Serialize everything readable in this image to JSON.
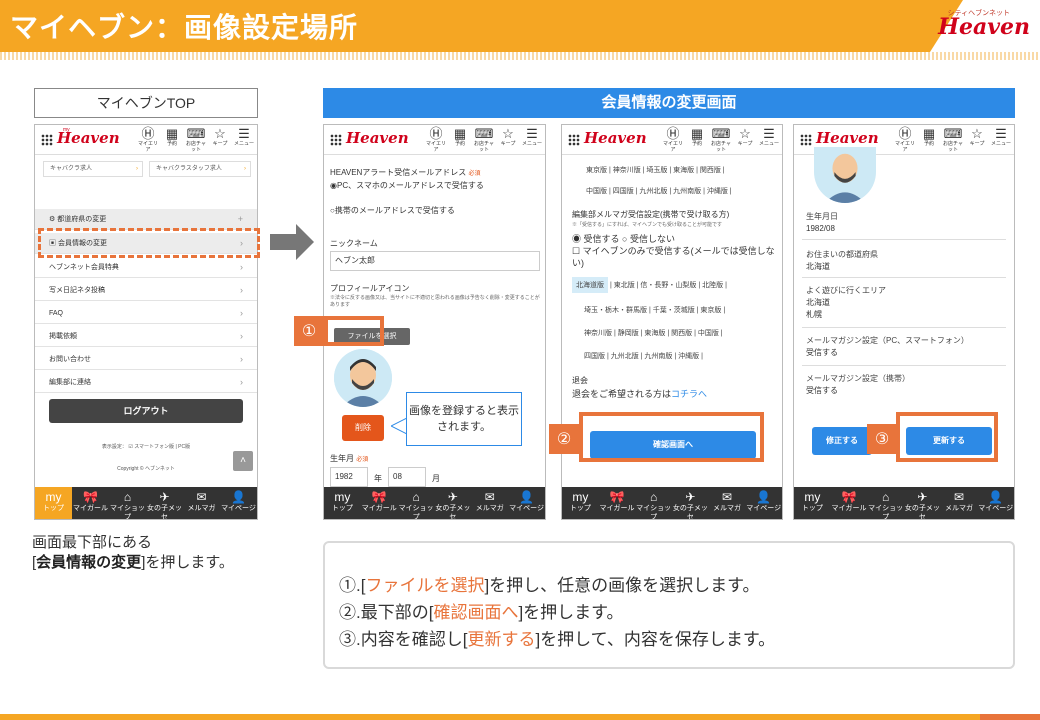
{
  "header": {
    "title": "マイヘブン：画像設定場所",
    "brand_small": "シティヘブンネット",
    "brand_big": "Heaven"
  },
  "left": {
    "top_label": "マイヘブンTOP",
    "phone": {
      "logo": "Heaven",
      "logo_tag": "my",
      "nav": [
        {
          "icon": "Ⓗ",
          "label": "マイエリア"
        },
        {
          "icon": "▦",
          "label": "予約"
        },
        {
          "icon": "⌨",
          "label": "お店チャット"
        },
        {
          "icon": "☆",
          "label": "キープ"
        },
        {
          "icon": "☰",
          "label": "メニュー"
        }
      ],
      "pills": [
        "キャバクラ求人",
        "キャバクラスタッフ求人"
      ],
      "menu": [
        {
          "label": "都道府県の変更",
          "icon": "gear"
        },
        {
          "label": "会員情報の変更",
          "icon": "card"
        },
        {
          "label": "ヘブンネット会員特典"
        },
        {
          "label": "写メ日記ネタ投稿"
        },
        {
          "label": "FAQ"
        },
        {
          "label": "掲載依頼"
        },
        {
          "label": "お問い合わせ"
        },
        {
          "label": "編集部に連絡"
        }
      ],
      "logout": "ログアウト",
      "display_setting": "表示設定：",
      "display_mode": "スマートフォン版 | PC版",
      "copyright": "Copyright © ヘブンネット",
      "tabs": [
        {
          "icon": "my",
          "label": "トップ"
        },
        {
          "icon": "🎀",
          "label": "マイガール"
        },
        {
          "icon": "⌂",
          "label": "マイショップ"
        },
        {
          "icon": "✈",
          "label": "女の子メッセ"
        },
        {
          "icon": "✉",
          "label": "メルマガ"
        },
        {
          "icon": "👤",
          "label": "マイページ"
        }
      ]
    },
    "caption_line1": "画面最下部にある",
    "caption_bold": "会員情報の変更",
    "caption_rest": "]を押します。",
    "caption_open": "["
  },
  "right": {
    "section_title": "会員情報の変更画面",
    "screen1": {
      "alert_label": "HEAVENアラート受信メールアドレス",
      "required": "必須",
      "radio1": "PC、スマホのメールアドレスで受信する",
      "radio2": "携帯のメールアドレスで受信する",
      "nick_label": "ニックネーム",
      "nick_value": "ヘブン太郎",
      "icon_label": "プロフィールアイコン",
      "icon_note": "※法令に反する画像又は、当サイトに不適切と思われる画像は予告なく削除・変更することがあります",
      "file_button": "ファイルを選択",
      "delete_button": "削除",
      "birth_label": "生年月",
      "birth_year": "1982",
      "birth_year_unit": "年",
      "birth_month": "08",
      "birth_month_unit": "月"
    },
    "callout": "画像を登録すると表示されます。",
    "badge1": "①",
    "badge2": "②",
    "badge3": "③",
    "screen2": {
      "regions_top": [
        "東京版 | 神奈川版 | 埼玉版 | 東海版 | 関西版 |",
        "中国版 | 四国版 | 九州北版 | 九州南版 | 沖縄版 |"
      ],
      "mag_label": "編集部メルマガ受信設定(携帯で受け取る方)",
      "mag_note": "※「受信する」にすれば、マイヘブンでも受け取ることが可能です",
      "opt_receive": "受信する",
      "opt_not": "受信しない",
      "opt_myheaven": "マイヘブンのみで受信する(メールでは受信しない)",
      "region_selected": "北海道版",
      "regions_rest1": "| 東北版 | 信・長野・山梨版 | 北陸版 |",
      "regions_rest2": "埼玉・栃木・群馬版 | 千葉・茨城版 | 東京版 |",
      "regions_rest3": "神奈川版 | 静岡版 | 東海版 | 関西版 | 中国版 |",
      "regions_rest4": "四国版 | 九州北版 | 九州南版 | 沖縄版 |",
      "withdraw_label": "退会",
      "withdraw_text": "退会をご希望される方は",
      "withdraw_link": "コチラへ",
      "confirm_button": "確認画面へ"
    },
    "screen3": {
      "birth_label": "生年月日",
      "birth_value": "1982/08",
      "pref_label": "お住まいの都道府県",
      "pref_value": "北海道",
      "area_label": "よく遊びに行くエリア",
      "area_value1": "北海道",
      "area_value2": "札幌",
      "mag_pc_label": "メールマガジン設定（PC、スマートフォン）",
      "mag_pc_value": "受信する",
      "mag_mobile_label": "メールマガジン設定（携帯）",
      "mag_mobile_value": "受信する",
      "edit_button": "修正する",
      "update_button": "更新する"
    },
    "notes": [
      {
        "prefix": "①.[",
        "hl": "ファイルを選択",
        "suffix": "]を押し、任意の画像を選択します。"
      },
      {
        "prefix": "②.最下部の[",
        "hl": "確認画面へ",
        "suffix": "]を押します。"
      },
      {
        "prefix": "③.内容を確認し[",
        "hl": "更新する",
        "suffix": "]を押して、内容を保存します。"
      }
    ]
  }
}
